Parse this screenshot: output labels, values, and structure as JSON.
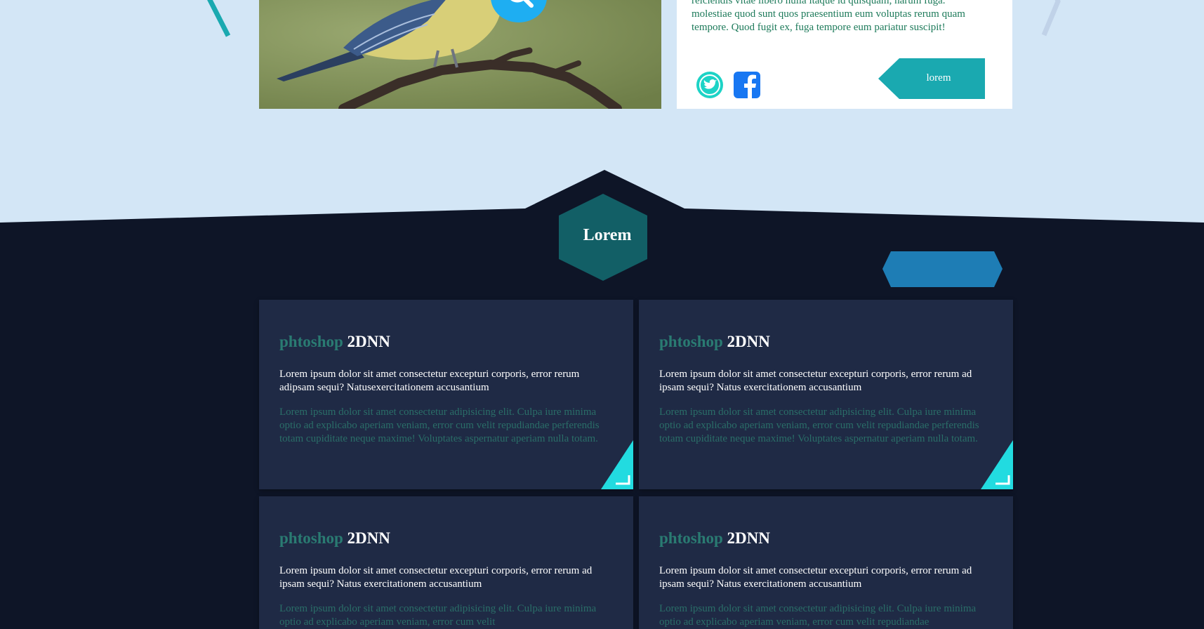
{
  "colors": {
    "sky": "#d3e6f6",
    "navy": "#0e1527",
    "card": "#1f2a45",
    "teal": "#1aa9b0",
    "accent_cyan": "#22dbe0",
    "blue": "#1e7db5",
    "green_text": "#1d7a5a"
  },
  "top_card": {
    "body_lines": [
      "reiciendis vitae libero nulla itaque id quisquam, harum fuga.",
      "molestiae quod sunt quos praesentium eum voluptas rerum quam tempore. Quod fugit ex, fuga tempore eum pariatur suscipit!"
    ],
    "tag_label": "lorem",
    "social": [
      "twitter-icon",
      "facebook-icon"
    ]
  },
  "section": {
    "title": "Lorem"
  },
  "cards": [
    {
      "title_a": "phtoshop",
      "title_b": "2DNN",
      "lead": "Lorem ipsum dolor sit amet consectetur excepturi corporis, error rerum adipsam sequi? Natusexercitationem accusantium",
      "muted": "Lorem ipsum dolor sit amet consectetur adipisicing elit. Culpa iure minima optio ad explicabo aperiam veniam, error cum velit repudiandae perferendis totam cupiditate neque maxime! Voluptates aspernatur aperiam nulla totam."
    },
    {
      "title_a": "phtoshop",
      "title_b": "2DNN",
      "lead": "Lorem ipsum dolor sit amet consectetur excepturi corporis, error rerum ad ipsam sequi? Natus exercitationem accusantium",
      "muted": "Lorem ipsum dolor sit amet consectetur adipisicing elit. Culpa iure minima optio ad explicabo aperiam veniam, error cum velit repudiandae perferendis totam cupiditate neque maxime! Voluptates aspernatur aperiam nulla totam."
    },
    {
      "title_a": "phtoshop",
      "title_b": "2DNN",
      "lead": "Lorem ipsum dolor sit amet consectetur excepturi corporis, error rerum ad ipsam sequi? Natus exercitationem accusantium",
      "muted": "Lorem ipsum dolor sit amet consectetur adipisicing elit. Culpa iure minima optio ad explicabo aperiam veniam, error cum velit"
    },
    {
      "title_a": "phtoshop",
      "title_b": "2DNN",
      "lead": "Lorem ipsum dolor sit amet consectetur excepturi corporis, error rerum ad ipsam sequi? Natus exercitationem accusantium",
      "muted": "Lorem ipsum dolor sit amet consectetur adipisicing elit. Culpa iure minima optio ad explicabo aperiam veniam, error cum velit repudiandae"
    }
  ]
}
